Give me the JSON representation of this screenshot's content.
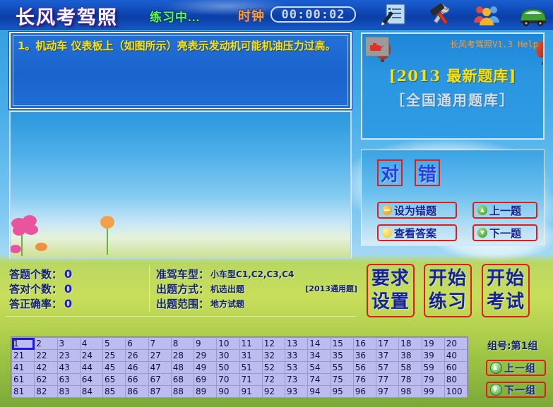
{
  "titlebar": {
    "app_title": "长风考驾照",
    "status": "练习中...",
    "clock_label": "时钟",
    "clock_value": "00:00:02",
    "icons": [
      {
        "name": "exam-paper-icon",
        "label": "考题"
      },
      {
        "name": "tools-icon",
        "label": "工具"
      },
      {
        "name": "users-icon",
        "label": "用户"
      },
      {
        "name": "car-icon",
        "label": "车型"
      }
    ]
  },
  "question": {
    "text": "1。机动车 仪表板上（如图所示）亮表示发动机可能机油压力过高。"
  },
  "right_top": {
    "version": "长风考驾照V1.3 Help",
    "db_new": "[2013 最新题库]",
    "db_general": "［全国通用题库］"
  },
  "answer_panel": {
    "true_label": "对",
    "false_label": "错",
    "mark_wrong": "设为错题",
    "show_answer": "查看答案",
    "prev_question": "上一题",
    "next_question": "下一题"
  },
  "stats": [
    {
      "label": "答题个数：",
      "value": "0"
    },
    {
      "label": "答对个数：",
      "value": "0"
    },
    {
      "label": "答正确率：",
      "value": "0"
    }
  ],
  "settings": {
    "rows": [
      {
        "label": "准驾车型：",
        "value": "小车型C1,C2,C3,C4"
      },
      {
        "label": "出题方式：",
        "value": "机选出题"
      },
      {
        "label": "出题范围：",
        "value": "地方试题"
      }
    ],
    "tag": "[2013通用题]"
  },
  "modes": [
    {
      "line1": "要求",
      "line2": "设置"
    },
    {
      "line1": "开始",
      "line2": "练习"
    },
    {
      "line1": "开始",
      "line2": "考试"
    }
  ],
  "grid": {
    "selected": 1,
    "rows": [
      [
        1,
        2,
        3,
        4,
        5,
        6,
        7,
        8,
        9,
        10,
        11,
        12,
        13,
        14,
        15,
        16,
        17,
        18,
        19,
        20
      ],
      [
        21,
        22,
        23,
        24,
        25,
        26,
        27,
        28,
        29,
        30,
        31,
        32,
        33,
        34,
        35,
        36,
        37,
        38,
        39,
        40
      ],
      [
        41,
        42,
        43,
        44,
        45,
        46,
        47,
        48,
        49,
        50,
        51,
        52,
        53,
        54,
        55,
        56,
        57,
        58,
        59,
        60
      ],
      [
        61,
        62,
        63,
        64,
        65,
        66,
        67,
        68,
        69,
        70,
        71,
        72,
        73,
        74,
        75,
        76,
        77,
        78,
        79,
        80
      ],
      [
        81,
        82,
        83,
        84,
        85,
        86,
        87,
        88,
        89,
        90,
        91,
        92,
        93,
        94,
        95,
        96,
        97,
        98,
        99,
        100
      ]
    ]
  },
  "group": {
    "label": "组号:第1组",
    "prev": "上一组",
    "next": "下一组"
  },
  "colors": {
    "title_blue": "#0e47b4",
    "question_yellow": "#ffe000",
    "accent_red": "#e01c1c",
    "text_navy": "#13236e",
    "status_green": "#5bff3a",
    "clock_orange": "#ff9a2e"
  }
}
